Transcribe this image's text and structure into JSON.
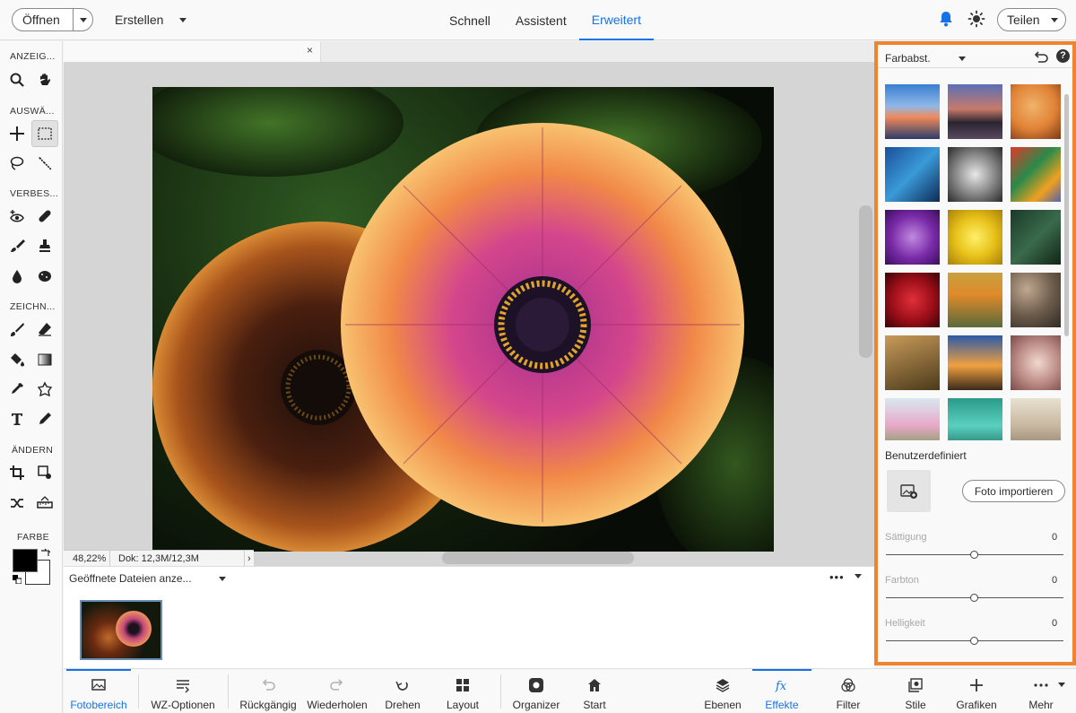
{
  "topbar": {
    "open_label": "Öffnen",
    "create_label": "Erstellen",
    "modes": [
      "Schnell",
      "Assistent",
      "Erweitert"
    ],
    "active_mode": "Erweitert",
    "share_label": "Teilen",
    "accent": "#1473e6"
  },
  "toolbar": {
    "sections": [
      "ANZEIG...",
      "AUSWÄ...",
      "VERBES...",
      "ZEICHN...",
      "ÄNDERN",
      "FARBE"
    ],
    "foreground_color": "#000000",
    "background_color": "#ffffff"
  },
  "document": {
    "close_glyph": "×",
    "zoom": "48,22%",
    "doc_size": "Dok: 12,3M/12,3M",
    "status_arrow": "›"
  },
  "photobin": {
    "dropdown_label": "Geöffnete Dateien anze...",
    "more_glyph": "•••"
  },
  "effects_panel": {
    "category": "Farbabst.",
    "custom_label": "Benutzerdefiniert",
    "import_label": "Foto importieren",
    "sliders": [
      {
        "label": "Sättigung",
        "value": "0"
      },
      {
        "label": "Farbton",
        "value": "0"
      },
      {
        "label": "Helligkeit",
        "value": "0"
      }
    ],
    "highlight_color": "#ee8330"
  },
  "bottombar": {
    "items": [
      {
        "label": "Fotobereich",
        "icon": "photo-bin-icon"
      },
      {
        "label": "WZ-Optionen",
        "icon": "tool-options-icon"
      },
      {
        "label": "Rückgängig",
        "icon": "undo-icon"
      },
      {
        "label": "Wiederholen",
        "icon": "redo-icon"
      },
      {
        "label": "Drehen",
        "icon": "rotate-icon"
      },
      {
        "label": "Layout",
        "icon": "layout-icon"
      },
      {
        "label": "Organizer",
        "icon": "organizer-icon"
      },
      {
        "label": "Start",
        "icon": "home-icon"
      },
      {
        "label": "Ebenen",
        "icon": "layers-icon"
      },
      {
        "label": "Effekte",
        "icon": "fx-icon"
      },
      {
        "label": "Filter",
        "icon": "filter-icon"
      },
      {
        "label": "Stile",
        "icon": "styles-icon"
      },
      {
        "label": "Grafiken",
        "icon": "plus-icon"
      },
      {
        "label": "Mehr",
        "icon": "more-icon"
      }
    ]
  }
}
